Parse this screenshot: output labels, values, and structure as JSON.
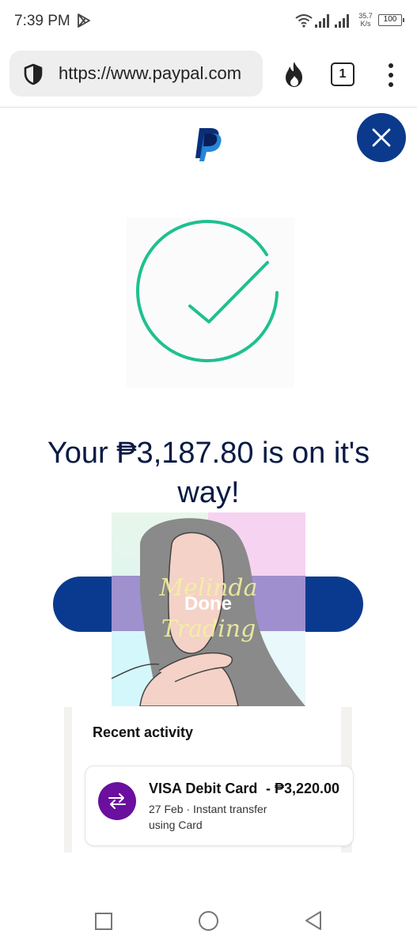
{
  "status_bar": {
    "time": "7:39 PM",
    "net_speed_value": "35.7",
    "net_speed_unit": "K/s",
    "battery": "100"
  },
  "browser": {
    "url": "https://www.paypal.com",
    "tab_count": "1"
  },
  "page": {
    "headline": "Your ₱3,187.80 is on it's way!",
    "done_button": "Done",
    "overlay_text": [
      "Melinda",
      "Trading"
    ],
    "recent_activity_title": "Recent activity",
    "transaction": {
      "name": "VISA Debit Card",
      "amount": "- ₱3,220.00",
      "meta": "27 Feb · Instant transfer using Card"
    }
  },
  "colors": {
    "paypal_blue": "#0a3a8f",
    "check_green": "#1fc08f",
    "txn_purple": "#6a0f9e"
  },
  "icons": [
    "play-store-icon",
    "wifi-icon",
    "signal-icon",
    "shield-icon",
    "fire-icon",
    "menu-dots-icon",
    "paypal-logo",
    "close-icon",
    "checkmark-icon",
    "transfer-icon",
    "nav-recents-icon",
    "nav-home-icon",
    "nav-back-icon"
  ]
}
